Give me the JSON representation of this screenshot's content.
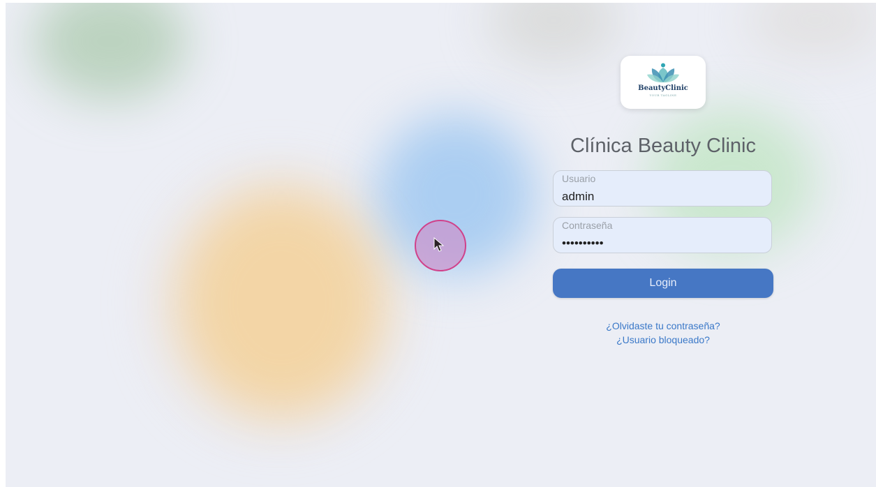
{
  "brand": {
    "logo_name": "BeautyClinic",
    "logo_tagline": "YOUR TAGLINE"
  },
  "title": "Clínica Beauty Clinic",
  "form": {
    "username": {
      "label": "Usuario",
      "value": "admin"
    },
    "password": {
      "label": "Contraseña",
      "value": "••••••••••"
    },
    "login_label": "Login"
  },
  "links": {
    "forgot_password": "¿Olvidaste tu contraseña?",
    "locked_user": "¿Usuario bloqueado?"
  },
  "colors": {
    "page_background": "#eceef5",
    "primary_button": "#4677c4",
    "link": "#3a78c8",
    "input_background": "#e5edfb",
    "cursor_ring": "#d0418a"
  },
  "icons": {
    "logo": "lotus-icon",
    "cursor": "mouse-pointer-icon"
  }
}
